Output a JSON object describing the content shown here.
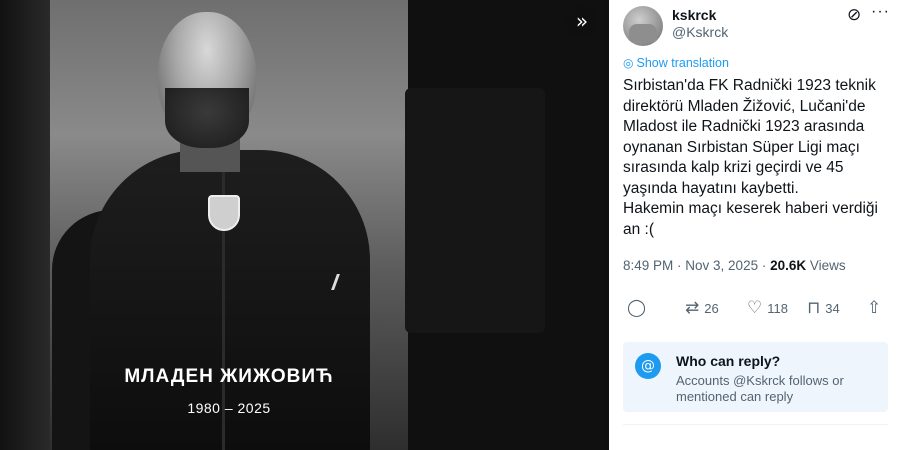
{
  "media": {
    "name": "МЛАДЕН ЖИЖОВИЋ",
    "years": "1980 – 2025",
    "collapse_icon": "chevrons-right-icon"
  },
  "tweet": {
    "display_name": "kskrck",
    "handle": "@Kskrck",
    "translate_label": "Show translation",
    "text": "Sırbistan'da FK Radnički 1923 teknik direktörü Mladen Žižović, Lučani'de Mladost ile Radnički 1923 arasında oynanan Sırbistan Süper Ligi maçı sırasında kalp krizi geçirdi ve 45 yaşında hayatını kaybetti.\nHakemin maçı keserek haberi verdiği an :(",
    "time": "8:49 PM",
    "date": "Nov 3, 2025",
    "views_count": "20.6K",
    "views_label": "Views",
    "retweets": "26",
    "likes": "118",
    "bookmarks": "34"
  },
  "reply_settings": {
    "title": "Who can reply?",
    "description": "Accounts @Kskrck follows or mentioned can reply"
  },
  "colors": {
    "accent": "#1d9bf0",
    "text": "#0f1419",
    "secondary": "#536471",
    "reply_bg": "#eef5fd"
  }
}
